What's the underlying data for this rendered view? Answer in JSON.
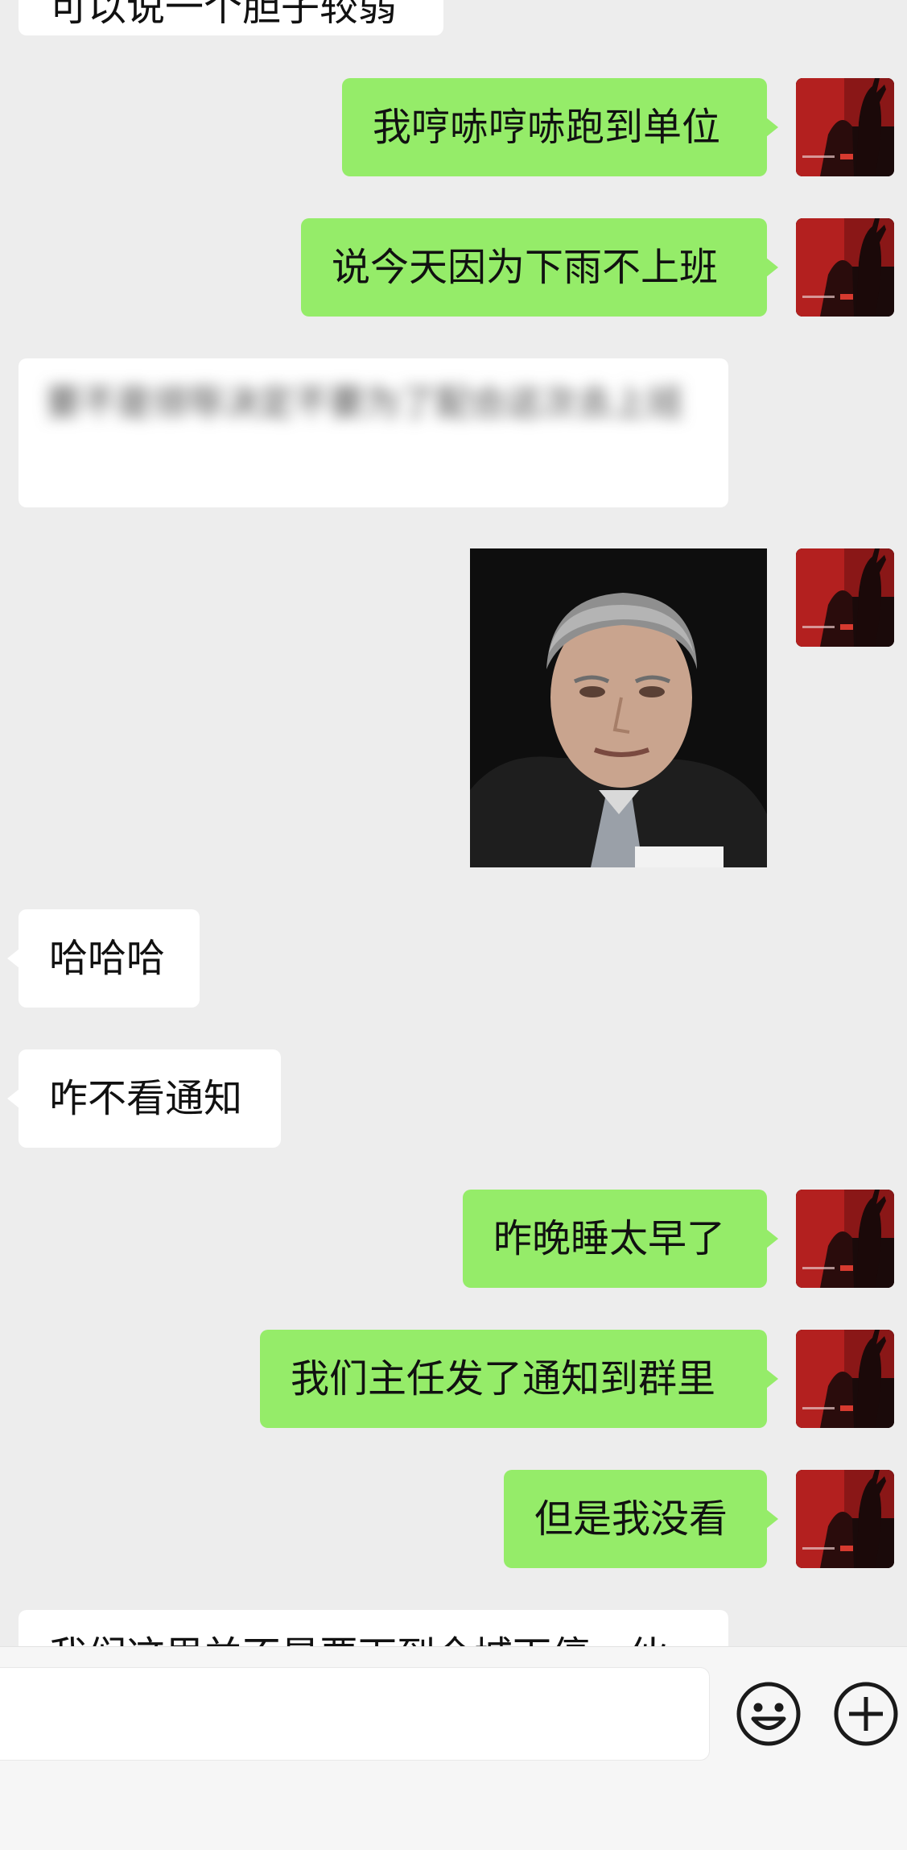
{
  "messages": [
    {
      "side": "them",
      "text": "可以说一个胆子较弱",
      "cut_off": "top"
    },
    {
      "side": "me",
      "text": "我哼哧哼哧跑到单位"
    },
    {
      "side": "me",
      "text": "说今天因为下雨不上班"
    },
    {
      "side": "them",
      "text": "要不是领导决定不要为了配合这次去上班",
      "blurred": true
    },
    {
      "side": "me",
      "type": "image",
      "image": "photo-of-older-man-in-suit"
    },
    {
      "side": "them",
      "text": "哈哈哈"
    },
    {
      "side": "them",
      "text": "咋不看通知"
    },
    {
      "side": "me",
      "text": "昨晚睡太早了"
    },
    {
      "side": "me",
      "text": "我们主任发了通知到群里"
    },
    {
      "side": "me",
      "text": "但是我没看"
    },
    {
      "side": "them",
      "text": "我们这里并不是要下到全城下停一伙",
      "cut_off": "bottom"
    }
  ],
  "input_bar": {
    "placeholder": "",
    "emoji_icon": "smiley-face-icon",
    "more_icon": "plus-circle-icon"
  },
  "colors": {
    "background": "#ededed",
    "my_bubble": "#95ec69",
    "their_bubble": "#ffffff",
    "input_bar": "#f6f6f6"
  }
}
